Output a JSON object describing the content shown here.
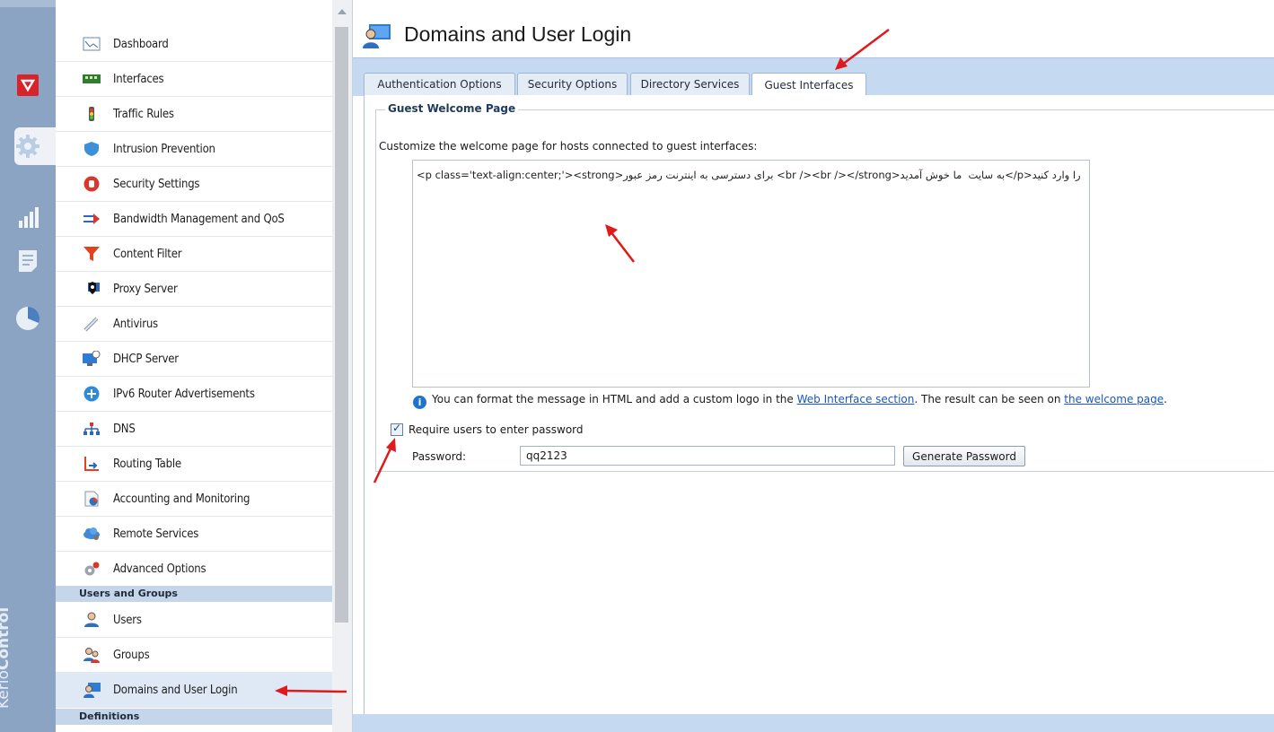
{
  "brand": {
    "prefix": "Kerio",
    "suffix": "Control"
  },
  "rail_icons": [
    "shield-icon",
    "settings-gear-icon",
    "bar-chart-icon",
    "logs-icon",
    "pie-status-icon"
  ],
  "nav": {
    "items": [
      {
        "label": "Dashboard",
        "icon": "dashboard-icon"
      },
      {
        "label": "Interfaces",
        "icon": "interfaces-icon"
      },
      {
        "label": "Traffic Rules",
        "icon": "traffic-light-icon"
      },
      {
        "label": "Intrusion Prevention",
        "icon": "shield-icon"
      },
      {
        "label": "Security Settings",
        "icon": "stop-hand-icon"
      },
      {
        "label": "Bandwidth Management and QoS",
        "icon": "bandwidth-arrows-icon"
      },
      {
        "label": "Content Filter",
        "icon": "funnel-icon"
      },
      {
        "label": "Proxy Server",
        "icon": "proxy-icon"
      },
      {
        "label": "Antivirus",
        "icon": "syringe-icon"
      },
      {
        "label": "DHCP Server",
        "icon": "dhcp-icon"
      },
      {
        "label": "IPv6 Router Advertisements",
        "icon": "ipv6-icon"
      },
      {
        "label": "DNS",
        "icon": "dns-tree-icon"
      },
      {
        "label": "Routing Table",
        "icon": "routing-icon"
      },
      {
        "label": "Accounting and Monitoring",
        "icon": "accounting-icon"
      },
      {
        "label": "Remote Services",
        "icon": "cloud-icon"
      },
      {
        "label": "Advanced Options",
        "icon": "gears-icon"
      }
    ],
    "group_users": "Users and Groups",
    "users_items": [
      {
        "label": "Users",
        "icon": "user-icon"
      },
      {
        "label": "Groups",
        "icon": "group-icon"
      },
      {
        "label": "Domains and User Login",
        "icon": "domain-user-icon"
      }
    ],
    "group_definitions": "Definitions"
  },
  "page": {
    "title": "Domains and User Login",
    "tabs": [
      "Authentication Options",
      "Security Options",
      "Directory Services",
      "Guest Interfaces"
    ],
    "active_tab": "Guest Interfaces",
    "section_title": "Guest Welcome Page",
    "description": "Customize the welcome page for hosts connected to guest interfaces:",
    "welcome_html": "<p class='text-align:center;'><strong>برای دسترسی به اینترنت رمز عبور <br /><br /></strong>به سایت  ما خوش آمدید</p>را وارد کنید",
    "info_prefix": "You can format the message in HTML and add a custom logo in the ",
    "info_link1": "Web Interface section",
    "info_mid": ". The result can be seen on ",
    "info_link2": "the welcome page",
    "info_suffix": ".",
    "require_password_label": "Require users to enter password",
    "require_password_checked": true,
    "password_label": "Password:",
    "password_value": "qq2123",
    "generate_button": "Generate Password"
  },
  "colors": {
    "rail": "#8ba4c4",
    "tabstrip": "#c5d9f1",
    "annotation_arrow": "#e0191b"
  }
}
